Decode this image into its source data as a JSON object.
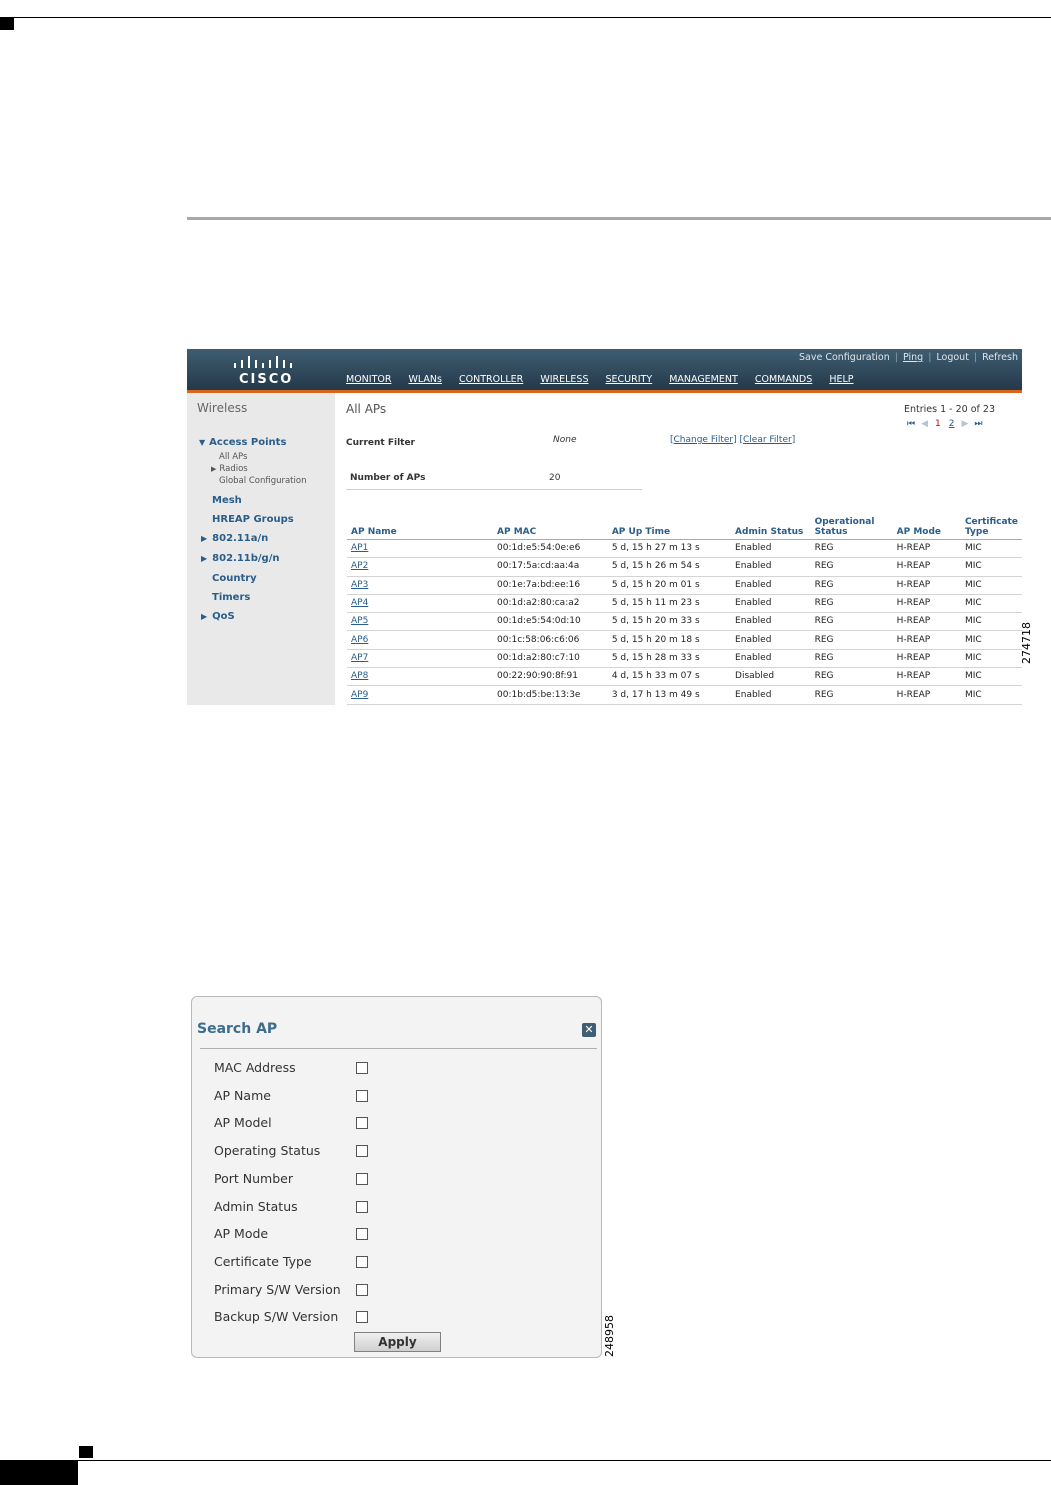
{
  "figure1": {
    "figure_number": "274718",
    "util_links": [
      "Save Configuration",
      "Ping",
      "Logout",
      "Refresh"
    ],
    "menu": [
      "MONITOR",
      "WLANs",
      "CONTROLLER",
      "WIRELESS",
      "SECURITY",
      "MANAGEMENT",
      "COMMANDS",
      "HELP"
    ],
    "logo_text": "CISCO",
    "sidebar": {
      "title": "Wireless",
      "access_points": "Access Points",
      "all_aps": "All APs",
      "radios": "Radios",
      "global_config": "Global Configuration",
      "mesh": "Mesh",
      "hreap_groups": "HREAP Groups",
      "a_n": "802.11a/n",
      "b_g_n": "802.11b/g/n",
      "country": "Country",
      "timers": "Timers",
      "qos": "QoS"
    },
    "content": {
      "title": "All APs",
      "entries": "Entries 1 - 20 of 23",
      "pager": {
        "first": "⏮",
        "prev": "◀",
        "current": "1",
        "next_page": "2",
        "next": "▶",
        "last": "⏭"
      },
      "current_filter_label": "Current Filter",
      "current_filter_value": "None",
      "change_filter": "Change Filter",
      "clear_filter": "Clear Filter",
      "num_aps_label": "Number of APs",
      "num_aps_value": "20"
    },
    "table": {
      "headers": [
        "AP Name",
        "AP MAC",
        "AP Up Time",
        "Admin Status",
        "Operational Status",
        "AP Mode",
        "Certificate Type"
      ],
      "rows": [
        [
          "AP1",
          "00:1d:e5:54:0e:e6",
          "5 d, 15 h 27 m 13 s",
          "Enabled",
          "REG",
          "H-REAP",
          "MIC"
        ],
        [
          "AP2",
          "00:17:5a:cd:aa:4a",
          "5 d, 15 h 26 m 54 s",
          "Enabled",
          "REG",
          "H-REAP",
          "MIC"
        ],
        [
          "AP3",
          "00:1e:7a:bd:ee:16",
          "5 d, 15 h 20 m 01 s",
          "Enabled",
          "REG",
          "H-REAP",
          "MIC"
        ],
        [
          "AP4",
          "00:1d:a2:80:ca:a2",
          "5 d, 15 h 11 m 23 s",
          "Enabled",
          "REG",
          "H-REAP",
          "MIC"
        ],
        [
          "AP5",
          "00:1d:e5:54:0d:10",
          "5 d, 15 h 20 m 33 s",
          "Enabled",
          "REG",
          "H-REAP",
          "MIC"
        ],
        [
          "AP6",
          "00:1c:58:06:c6:06",
          "5 d, 15 h 20 m 18 s",
          "Enabled",
          "REG",
          "H-REAP",
          "MIC"
        ],
        [
          "AP7",
          "00:1d:a2:80:c7:10",
          "5 d, 15 h 28 m 33 s",
          "Enabled",
          "REG",
          "H-REAP",
          "MIC"
        ],
        [
          "AP8",
          "00:22:90:90:8f:91",
          "4 d, 15 h 33 m 07 s",
          "Disabled",
          "REG",
          "H-REAP",
          "MIC"
        ],
        [
          "AP9",
          "00:1b:d5:be:13:3e",
          "3 d, 17 h 13 m 49 s",
          "Enabled",
          "REG",
          "H-REAP",
          "MIC"
        ]
      ]
    }
  },
  "figure2": {
    "figure_number": "248958",
    "title": "Search AP",
    "options": [
      "MAC Address",
      "AP Name",
      "AP Model",
      "Operating Status",
      "Port Number",
      "Admin Status",
      "AP Mode",
      "Certificate Type",
      "Primary S/W Version",
      "Backup S/W Version"
    ],
    "apply": "Apply"
  }
}
